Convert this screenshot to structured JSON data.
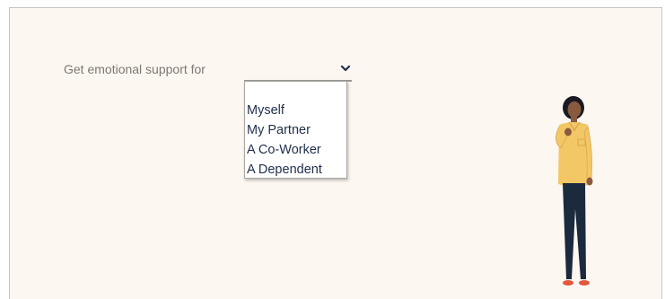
{
  "form": {
    "prompt_label": "Get emotional support for",
    "selected_value": "",
    "options": [
      "Myself",
      "My Partner",
      "A Co-Worker",
      "A Dependent"
    ]
  },
  "icons": {
    "dropdown": "chevron-down-icon",
    "illustration": "woman-standing-illustration"
  },
  "colors": {
    "card_background": "#fcf7f1",
    "option_text": "#1f2f4a",
    "label_text": "#7d7873",
    "shirt": "#f3c766",
    "pants": "#1b2a3d",
    "shoes": "#e3573c"
  }
}
